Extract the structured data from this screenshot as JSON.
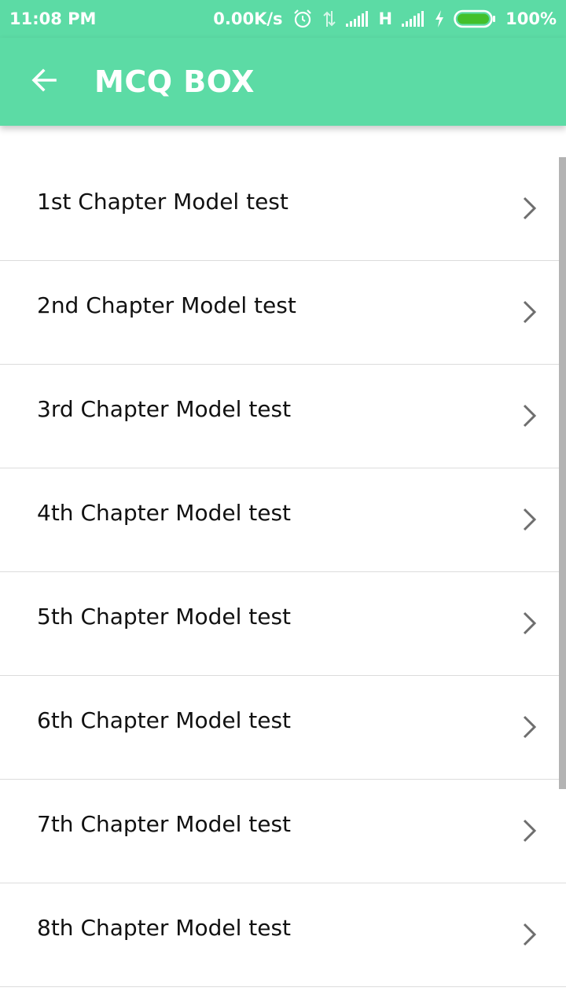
{
  "status_bar": {
    "time": "11:08 PM",
    "network_speed": "0.00K/s",
    "network_type": "H",
    "battery": "100%",
    "icons": [
      "alarm-icon",
      "data-transfer-icon",
      "signal-icon",
      "signal-icon",
      "charging-icon",
      "battery-icon"
    ]
  },
  "app_bar": {
    "back_icon": "arrow-left-icon",
    "title": "MCQ BOX"
  },
  "list": {
    "items": [
      {
        "label": "1st Chapter Model test"
      },
      {
        "label": "2nd Chapter Model test"
      },
      {
        "label": "3rd Chapter Model test"
      },
      {
        "label": "4th Chapter Model test"
      },
      {
        "label": "5th Chapter Model test"
      },
      {
        "label": "6th Chapter Model test"
      },
      {
        "label": "7th Chapter Model test"
      },
      {
        "label": "8th Chapter Model test"
      }
    ],
    "item_icon": "chevron-right-icon"
  },
  "colors": {
    "accent": "#5cdba5",
    "divider": "#dcdcdc",
    "chevron": "#6e6e6e",
    "scrollbar": "#b3b3b3",
    "battery_fill": "#43c02b"
  }
}
